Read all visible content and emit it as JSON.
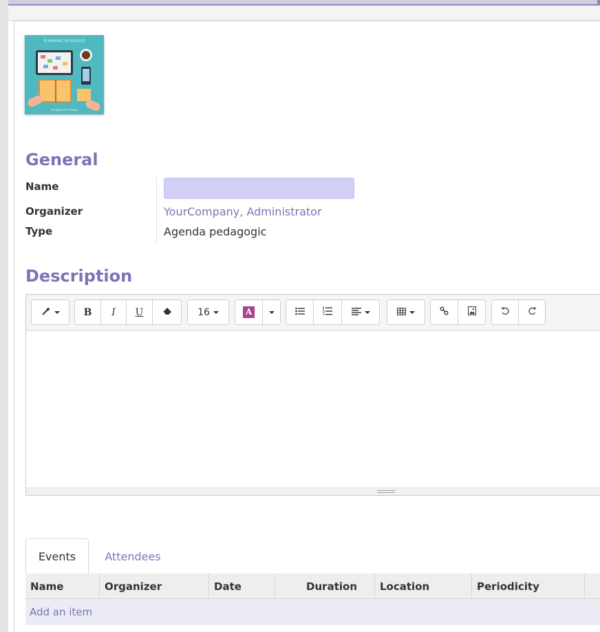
{
  "cover": {
    "caption": "PLANNING SCHEDULE",
    "footer": "designed by freepik"
  },
  "general": {
    "title": "General",
    "fields": {
      "name_label": "Name",
      "name_value": "",
      "organizer_label": "Organizer",
      "organizer_value": "YourCompany, Administrator",
      "type_label": "Type",
      "type_value": "Agenda pedagogic"
    }
  },
  "description": {
    "title": "Description",
    "toolbar": {
      "style_icon": "magic-wand-icon",
      "bold": "B",
      "italic": "I",
      "underline": "U",
      "eraser_icon": "eraser-icon",
      "font_size": "16",
      "color_letter": "A",
      "color_accent": "#a9428f",
      "bullet_list_icon": "unordered-list-icon",
      "numbered_list_icon": "ordered-list-icon",
      "align_icon": "align-left-icon",
      "table_icon": "table-icon",
      "link_icon": "link-icon",
      "image_icon": "image-icon",
      "undo_icon": "undo-icon",
      "redo_icon": "redo-icon"
    },
    "content": ""
  },
  "tabs": [
    {
      "label": "Events",
      "active": true
    },
    {
      "label": "Attendees",
      "active": false
    }
  ],
  "table": {
    "columns": [
      "Name",
      "Organizer",
      "Date",
      "Duration",
      "Location",
      "Periodicity"
    ],
    "add_item": "Add an item"
  },
  "colors": {
    "accent": "#7b75b6",
    "input_required": "#d2d0f7"
  }
}
